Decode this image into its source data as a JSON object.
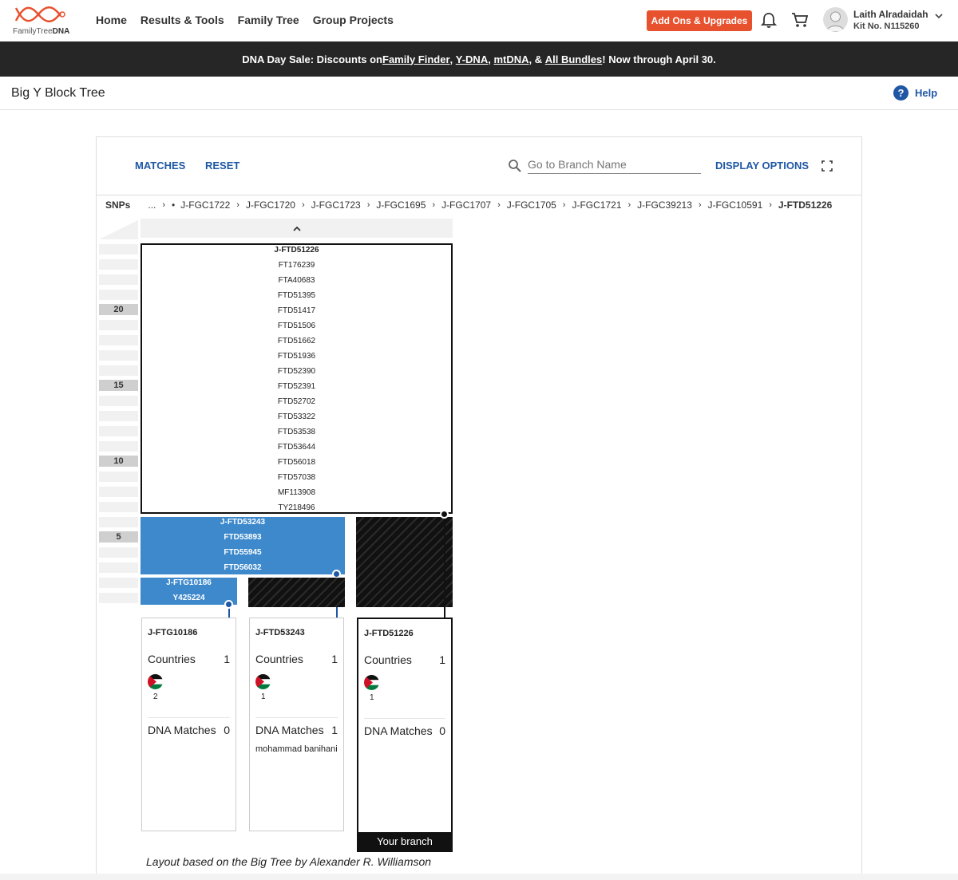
{
  "brand": {
    "logo_text_1": "FamilyTree",
    "logo_text_2": "DNA",
    "accent": "#e8512e"
  },
  "nav": {
    "items": [
      "Home",
      "Results & Tools",
      "Family Tree",
      "Group Projects"
    ]
  },
  "header": {
    "addons_label": "Add Ons & Upgrades",
    "user_name": "Laith Alradaidah",
    "kit_number": "Kit No. N115260"
  },
  "banner": {
    "prefix": "DNA Day Sale: Discounts on ",
    "links": [
      "Family Finder",
      "Y-DNA",
      "mtDNA",
      "All Bundles"
    ],
    "suffix": "! Now through April 30."
  },
  "page": {
    "title": "Big Y Block Tree",
    "help_label": "Help"
  },
  "toolbar": {
    "matches_label": "MATCHES",
    "reset_label": "RESET",
    "search_placeholder": "Go to Branch Name",
    "display_options_label": "DISPLAY OPTIONS"
  },
  "breadcrumb": {
    "label": "SNPs",
    "ellipsis": "...",
    "bullet": "•",
    "items": [
      "J-FGC1722",
      "J-FGC1720",
      "J-FGC1723",
      "J-FGC1695",
      "J-FGC1707",
      "J-FGC1705",
      "J-FGC1721",
      "J-FGC39213",
      "J-FGC10591",
      "J-FTD51226"
    ]
  },
  "ruler": {
    "labels": [
      "20",
      "15",
      "10",
      "5"
    ]
  },
  "main_block": {
    "name": "J-FTD51226",
    "snps": [
      "FT176239",
      "FTA40683",
      "FTD51395",
      "FTD51417",
      "FTD51506",
      "FTD51662",
      "FTD51936",
      "FTD52390",
      "FTD52391",
      "FTD52702",
      "FTD53322",
      "FTD53538",
      "FTD53644",
      "FTD56018",
      "FTD57038",
      "MF113908",
      "TY218496"
    ]
  },
  "sub_block": {
    "name": "J-FTD53243",
    "snps": [
      "FTD53893",
      "FTD55945",
      "FTD56032"
    ]
  },
  "leaf_block": {
    "name": "J-FTG10186",
    "snps": [
      "Y425224"
    ]
  },
  "colors": {
    "branch_blue": "#3d89cc",
    "link_blue": "#1f57a4",
    "dark": "#111111"
  },
  "cards": [
    {
      "title": "J-FTG10186",
      "countries_label": "Countries",
      "countries_count": "1",
      "flag_count": "2",
      "matches_label": "DNA Matches",
      "matches_count": "0",
      "match_name": ""
    },
    {
      "title": "J-FTD53243",
      "countries_label": "Countries",
      "countries_count": "1",
      "flag_count": "1",
      "matches_label": "DNA Matches",
      "matches_count": "1",
      "match_name": "mohammad banihani"
    },
    {
      "title": "J-FTD51226",
      "countries_label": "Countries",
      "countries_count": "1",
      "flag_count": "1",
      "matches_label": "DNA Matches",
      "matches_count": "0",
      "match_name": "",
      "your_branch_label": "Your branch"
    }
  ],
  "footer": {
    "note": "Layout based on the Big Tree by Alexander R. Williamson"
  }
}
